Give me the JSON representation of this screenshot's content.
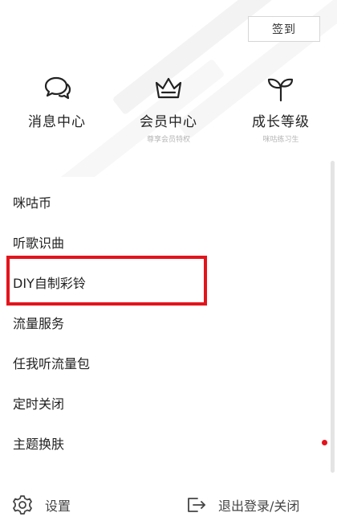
{
  "header": {
    "signin_label": "签到"
  },
  "quick_entries": [
    {
      "title": "消息中心",
      "subtitle": "",
      "icon": "chat-bubbles-icon"
    },
    {
      "title": "会员中心",
      "subtitle": "尊享会员特权",
      "icon": "crown-icon"
    },
    {
      "title": "成长等级",
      "subtitle": "咪咕练习生",
      "icon": "sprout-icon"
    }
  ],
  "menu": {
    "items": [
      {
        "label": "咪咕币"
      },
      {
        "label": "听歌识曲"
      },
      {
        "label": "DIY自制彩铃"
      },
      {
        "label": "流量服务"
      },
      {
        "label": "任我听流量包"
      },
      {
        "label": "定时关闭"
      },
      {
        "label": "主题换肤",
        "badge": "red-dot"
      }
    ]
  },
  "footer": {
    "settings_label": "设置",
    "logout_label": "退出登录/关闭"
  },
  "colors": {
    "highlight": "#e3141c",
    "badge": "#e3141c",
    "text": "#222222",
    "subtext": "#b5b5b5"
  }
}
